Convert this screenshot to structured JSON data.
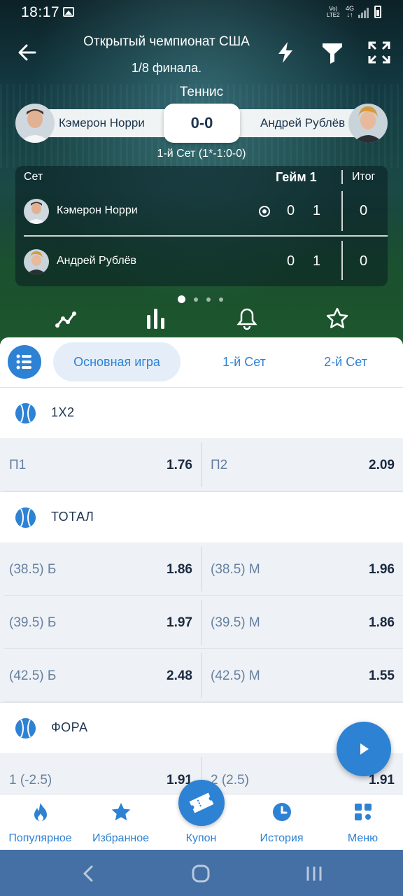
{
  "status_bar": {
    "time": "18:17",
    "network_top": "Vo)",
    "network_bottom": "LTE2",
    "gen": "4G"
  },
  "header": {
    "title": "Открытый чемпионат США",
    "subtitle": "1/8 финала.",
    "sport": "Теннис"
  },
  "match": {
    "player1": "Кэмерон Норри",
    "player2": "Андрей Рублёв",
    "score": "0-0",
    "set_info": "1-й Сет (1*-1:0-0)"
  },
  "scoreboard": {
    "col_set": "Сет",
    "col_game": "Гейм 1",
    "col_total": "Итог",
    "rows": [
      {
        "name": "Кэмерон Норри",
        "set": "0",
        "game": "1",
        "total": "0",
        "serving": true
      },
      {
        "name": "Андрей Рублёв",
        "set": "0",
        "game": "1",
        "total": "0",
        "serving": false
      }
    ]
  },
  "tabs": [
    {
      "label": "Основная игра",
      "active": true
    },
    {
      "label": "1-й Сет",
      "active": false
    },
    {
      "label": "2-й Сет",
      "active": false
    }
  ],
  "markets": [
    {
      "title": "1X2",
      "rows": [
        [
          {
            "label": "П1",
            "odd": "1.76"
          },
          {
            "label": "П2",
            "odd": "2.09"
          }
        ]
      ]
    },
    {
      "title": "ТОТАЛ",
      "rows": [
        [
          {
            "label": "(38.5) Б",
            "odd": "1.86"
          },
          {
            "label": "(38.5) М",
            "odd": "1.96"
          }
        ],
        [
          {
            "label": "(39.5) Б",
            "odd": "1.97"
          },
          {
            "label": "(39.5) М",
            "odd": "1.86"
          }
        ],
        [
          {
            "label": "(42.5) Б",
            "odd": "2.48"
          },
          {
            "label": "(42.5) М",
            "odd": "1.55"
          }
        ]
      ]
    },
    {
      "title": "ФОРА",
      "rows": [
        [
          {
            "label": "1 (-2.5)",
            "odd": "1.91"
          },
          {
            "label": "2 (2.5)",
            "odd": "1.91"
          }
        ]
      ]
    }
  ],
  "bottom_nav": [
    {
      "label": "Популярное",
      "icon": "flame-icon"
    },
    {
      "label": "Избранное",
      "icon": "star-icon"
    },
    {
      "label": "Купон",
      "icon": "ticket-icon"
    },
    {
      "label": "История",
      "icon": "clock-icon"
    },
    {
      "label": "Меню",
      "icon": "grid-icon"
    }
  ],
  "colors": {
    "accent": "#2d82d4",
    "text_dark": "#1a2a40",
    "label_muted": "#6680a0",
    "android_nav": "#4470a6"
  }
}
